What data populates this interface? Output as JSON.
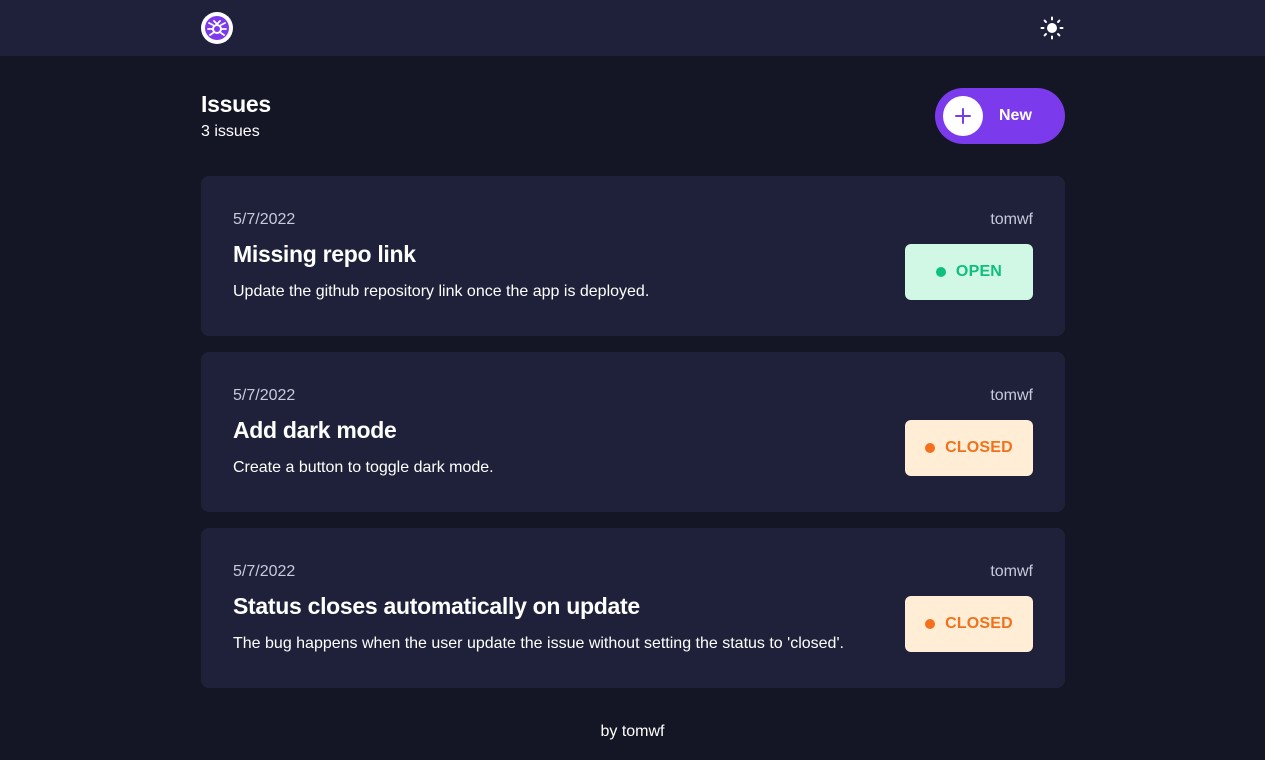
{
  "header": {
    "title": "Issues",
    "count": "3 issues",
    "new_button_label": "New"
  },
  "nav": {
    "logo_icon": "bug-icon",
    "theme_icon": "sun-icon"
  },
  "issues": [
    {
      "date": "5/7/2022",
      "author": "tomwf",
      "title": "Missing repo link",
      "description": "Update the github repository link once the app is deployed.",
      "status": "OPEN",
      "status_color": "#0fbf7e",
      "status_bg": "#d1f8e4"
    },
    {
      "date": "5/7/2022",
      "author": "tomwf",
      "title": "Add dark mode",
      "description": "Create a button to toggle dark mode.",
      "status": "CLOSED",
      "status_color": "#f2711c",
      "status_bg": "#ffedd5"
    },
    {
      "date": "5/7/2022",
      "author": "tomwf",
      "title": "Status closes automatically on update",
      "description": "The bug happens when the user update the issue without setting the status to 'closed'.",
      "status": "CLOSED",
      "status_color": "#f2711c",
      "status_bg": "#ffedd5"
    }
  ],
  "footer": {
    "text": "by tomwf"
  },
  "colors": {
    "accent": "#7c3aed",
    "background": "#141625",
    "surface": "#1e2139"
  }
}
